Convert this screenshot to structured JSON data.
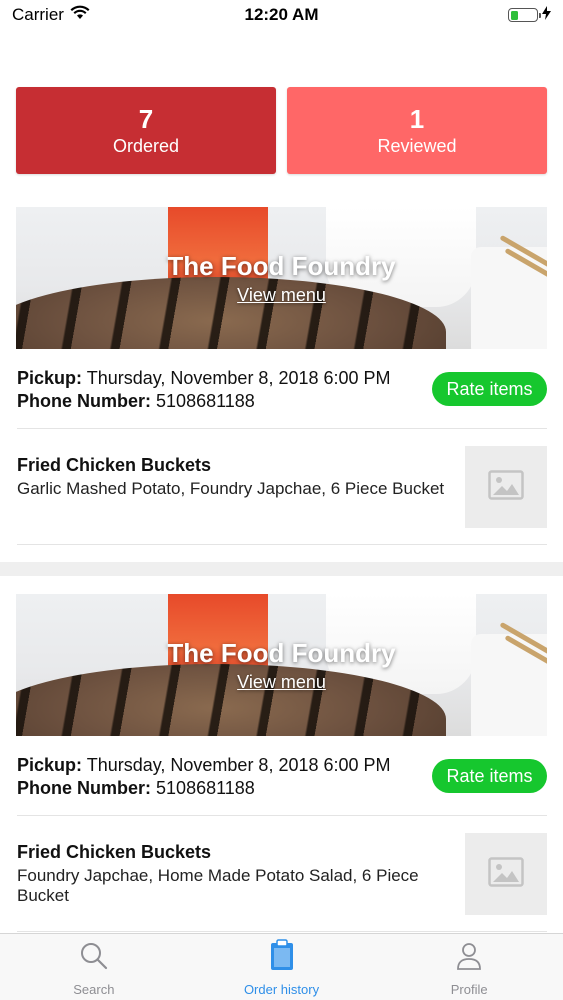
{
  "status_bar": {
    "carrier": "Carrier",
    "time": "12:20 AM",
    "battery_level": 0.3,
    "battery_color": "#2fbf3a"
  },
  "stats": {
    "ordered": {
      "count": "7",
      "label": "Ordered",
      "color": "#c62e33"
    },
    "reviewed": {
      "count": "1",
      "label": "Reviewed",
      "color": "#ff6767"
    }
  },
  "orders": [
    {
      "restaurant": "The Food Foundry",
      "view_menu": "View menu",
      "pickup_label": "Pickup:",
      "pickup_value": "Thursday, November 8, 2018 6:00 PM",
      "phone_label": "Phone Number:",
      "phone_value": "5108681188",
      "rate_button": "Rate items",
      "item_name": "Fried Chicken Buckets",
      "item_desc": "Garlic Mashed Potato, Foundry Japchae, 6 Piece Bucket",
      "item_image_icon": "image-placeholder-icon"
    },
    {
      "restaurant": "The Food Foundry",
      "view_menu": "View menu",
      "pickup_label": "Pickup:",
      "pickup_value": "Thursday, November 8, 2018 6:00 PM",
      "phone_label": "Phone Number:",
      "phone_value": "5108681188",
      "rate_button": "Rate items",
      "item_name": "Fried Chicken Buckets",
      "item_desc": "Foundry Japchae, Home Made Potato Salad, 6 Piece Bucket",
      "item_image_icon": "image-placeholder-icon"
    }
  ],
  "tabs": [
    {
      "label": "Search",
      "icon": "search-icon",
      "active": false
    },
    {
      "label": "Order history",
      "icon": "clipboard-icon",
      "active": true
    },
    {
      "label": "Profile",
      "icon": "person-icon",
      "active": false
    }
  ],
  "colors": {
    "accent_green": "#16c72e",
    "tab_active": "#2f8fe8",
    "tab_inactive": "#8e8e93"
  }
}
